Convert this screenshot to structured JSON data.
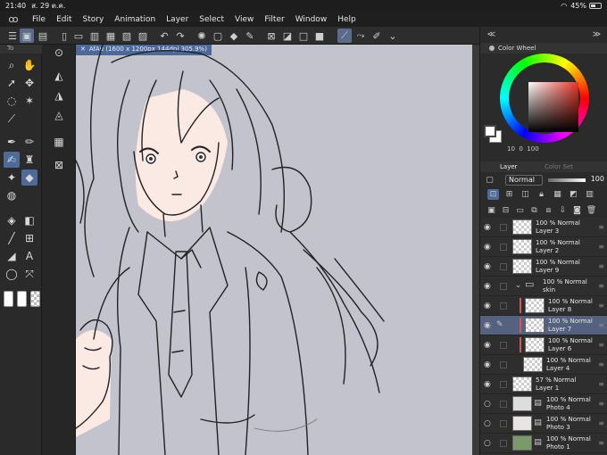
{
  "status": {
    "time": "21:40",
    "date": "ส. 29 ต.ค.",
    "battery": "45%",
    "wifi_icon": "wifi-icon"
  },
  "menu": [
    "File",
    "Edit",
    "Story",
    "Animation",
    "Layer",
    "Select",
    "View",
    "Filter",
    "Window",
    "Help"
  ],
  "tool_tab": "To",
  "canvas": {
    "tab_title": "AfAu (1600 x 1200px 144dpi 305.9%)",
    "background": "#c2c3cd"
  },
  "color_wheel": {
    "title": "Color Wheel",
    "hsv": [
      "10",
      "0",
      "100"
    ]
  },
  "layer_panel": {
    "tab_layer": "Layer",
    "tab_colorset": "Color Set",
    "blend_mode": "Normal",
    "opacity": "100",
    "layers": [
      {
        "opacity": "100 %",
        "mode": "Normal",
        "name": "Layer 3"
      },
      {
        "opacity": "100 %",
        "mode": "Normal",
        "name": "Layer 2"
      },
      {
        "opacity": "100 %",
        "mode": "Normal",
        "name": "Layer 9"
      },
      {
        "opacity": "100 %",
        "mode": "Normal",
        "name": "skin"
      },
      {
        "opacity": "100 %",
        "mode": "Normal",
        "name": "Layer 8"
      },
      {
        "opacity": "100 %",
        "mode": "Normal",
        "name": "Layer 7"
      },
      {
        "opacity": "100 %",
        "mode": "Normal",
        "name": "Layer 6"
      },
      {
        "opacity": "100 %",
        "mode": "Normal",
        "name": "Layer 4"
      },
      {
        "opacity": "57 %",
        "mode": "Normal",
        "name": "Layer 1"
      },
      {
        "opacity": "100 %",
        "mode": "Normal",
        "name": "Photo 4"
      },
      {
        "opacity": "100 %",
        "mode": "Normal",
        "name": "Photo 3"
      },
      {
        "opacity": "100 %",
        "mode": "Normal",
        "name": "Photo 1"
      }
    ]
  },
  "colors": {
    "accent": "#4e6a97",
    "selected_layer": "#54627f",
    "fg": "#ffffff",
    "bg": "#ffffff"
  }
}
